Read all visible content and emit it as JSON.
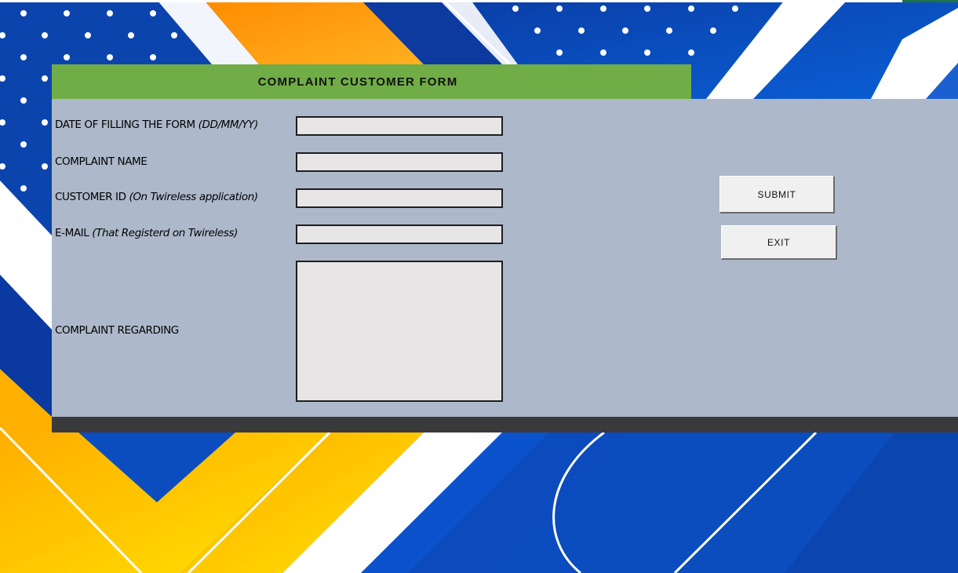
{
  "form": {
    "title": "COMPLAINT CUSTOMER FORM",
    "fields": [
      {
        "label": "DATE OF FILLING THE FORM ",
        "hint": "(DD/MM/YY)",
        "value": ""
      },
      {
        "label": "COMPLAINT NAME",
        "hint": "",
        "value": ""
      },
      {
        "label": "CUSTOMER ID ",
        "hint": "(On Twireless application)",
        "value": ""
      },
      {
        "label": "E-MAIL ",
        "hint": "(That Registerd on Twireless)",
        "value": ""
      }
    ],
    "complaint_label": "COMPLAINT REGARDING",
    "complaint_value": "",
    "submit_label": "SUBMIT",
    "exit_label": "EXIT"
  },
  "colors": {
    "header_green": "#70ad47",
    "panel_gray": "#adb9ca",
    "footer_dark": "#3a3a3c",
    "field_fill": "#e7e5e6",
    "bg_blue": "#0a47b4",
    "bg_orange": "#ffa31a",
    "bg_yellow": "#ffd000"
  }
}
